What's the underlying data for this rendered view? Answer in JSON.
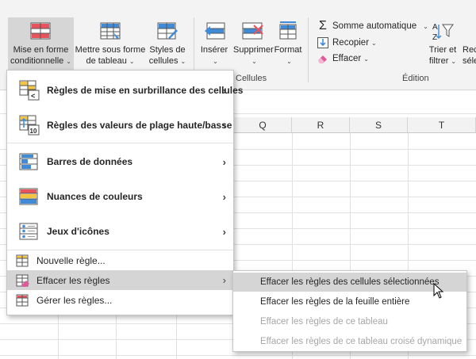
{
  "ribbon": {
    "conditional_formatting": {
      "line1": "Mise en forme",
      "line2": "conditionnelle"
    },
    "format_as_table": {
      "line1": "Mettre sous forme",
      "line2": "de tableau"
    },
    "cell_styles": {
      "line1": "Styles de",
      "line2": "cellules"
    },
    "insert": "Insérer",
    "delete": "Supprimer",
    "format": "Format",
    "cells_group": "Cellules",
    "autosum": "Somme automatique",
    "fill": "Recopier",
    "clear": "Effacer",
    "sort_filter": {
      "line1": "Trier et",
      "line2": "filtrer"
    },
    "find_partial": {
      "line1": "Rec",
      "line2": "sélec"
    },
    "editing_group": "Édition"
  },
  "sheet": {
    "columns": [
      "Q",
      "R",
      "S",
      "T"
    ]
  },
  "menu": {
    "items": [
      {
        "label": "Règles de mise en surbrillance des cellules",
        "icon": "highlight-rules-icon"
      },
      {
        "label": "Règles des valeurs de plage haute/basse",
        "icon": "top-bottom-rules-icon"
      },
      {
        "label": "Barres de données",
        "icon": "data-bars-icon"
      },
      {
        "label": "Nuances de couleurs",
        "icon": "color-scales-icon"
      },
      {
        "label": "Jeux d'icônes",
        "icon": "icon-sets-icon"
      }
    ],
    "new_rule": "Nouvelle règle...",
    "clear_rules": "Effacer les règles",
    "manage_rules": "Gérer les règles..."
  },
  "submenu": {
    "items": [
      {
        "label": "Effacer les règles  des cellules sélectionnées",
        "enabled": true
      },
      {
        "label": "Effacer les règles de la feuille entière",
        "enabled": true
      },
      {
        "label": "Effacer les règles de ce tableau",
        "enabled": false
      },
      {
        "label": "Effacer les règles  de ce tableau croisé dynamique",
        "enabled": false
      }
    ]
  },
  "colors": {
    "accent_blue": "#3f8bd8",
    "accent_red": "#e8545c",
    "accent_yellow": "#f5c542",
    "highlight": "#d5d5d5",
    "disabled_text": "#a6a6a6"
  }
}
